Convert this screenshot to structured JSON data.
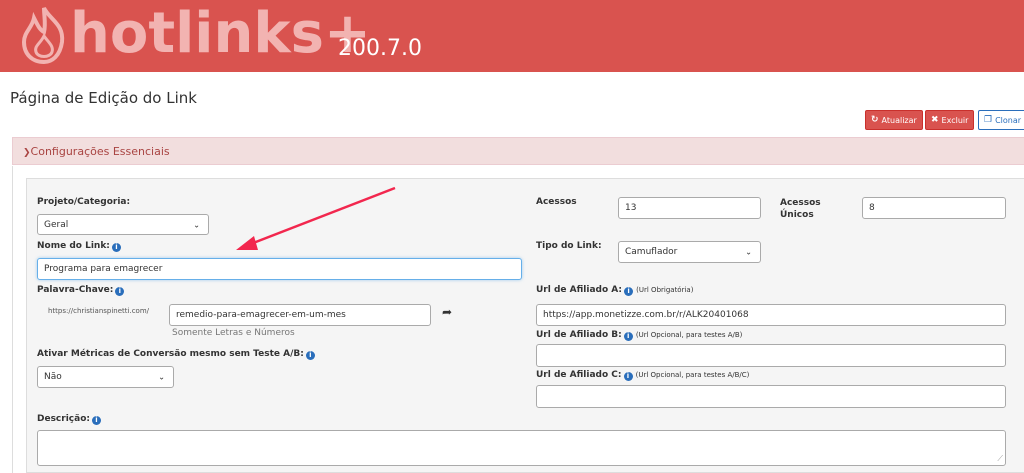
{
  "header": {
    "logo_text": "hotlinks+",
    "version": "200.7.0",
    "brand_color": "#d9534f"
  },
  "page": {
    "title": "Página de Edição do Link"
  },
  "toolbar": {
    "update_label": "Atualizar",
    "delete_label": "Excluir",
    "clone_label": "Clonar"
  },
  "panel": {
    "title": "Configurações Essenciais"
  },
  "form": {
    "project": {
      "label": "Projeto/Categoria:",
      "value": "Geral"
    },
    "link_name": {
      "label": "Nome do Link:",
      "value": "Programa para emagrecer"
    },
    "keyword": {
      "label": "Palavra-Chave:",
      "prefix": "https://christianspinetti.com/",
      "value": "remedio-para-emagrecer-em-um-mes",
      "helper": "Somente Letras e Números"
    },
    "metrics": {
      "label": "Ativar Métricas de Conversão mesmo sem Teste A/B:",
      "value": "Não"
    },
    "description": {
      "label": "Descrição:",
      "value": ""
    },
    "accesses": {
      "label": "Acessos",
      "value": "13"
    },
    "unique": {
      "label_line1": "Acessos",
      "label_line2": "Únicos",
      "value": "8"
    },
    "link_type": {
      "label": "Tipo do Link:",
      "value": "Camuflador"
    },
    "affiliate_a": {
      "label": "Url de Afiliado A:",
      "note": "(Url Obrigatória)",
      "value": "https://app.monetizze.com.br/r/ALK20401068"
    },
    "affiliate_b": {
      "label": "Url de Afiliado B:",
      "note": "(Url Opcional, para testes A/B)",
      "value": ""
    },
    "affiliate_c": {
      "label": "Url de Afiliado C:",
      "note": "(Url Opcional, para testes A/B/C)",
      "value": ""
    }
  },
  "icons": {
    "flame": "flame-icon",
    "refresh": "refresh-icon",
    "delete": "times-icon",
    "clone": "copy-icon",
    "chevron": "chevron-down-icon",
    "info": "info-icon",
    "share": "share-arrow-icon"
  }
}
